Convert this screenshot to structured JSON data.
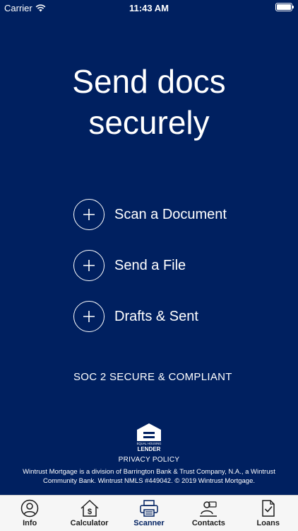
{
  "status_bar": {
    "carrier": "Carrier",
    "time": "11:43 AM"
  },
  "headline": {
    "line1": "Send docs",
    "line2": "securely"
  },
  "actions": [
    {
      "label": "Scan a Document"
    },
    {
      "label": "Send a File"
    },
    {
      "label": "Drafts & Sent"
    }
  ],
  "soc": "SOC 2 SECURE & COMPLIANT",
  "equal_housing": {
    "top": "EQUAL HOUSING",
    "bottom": "LENDER"
  },
  "privacy_policy": "PRIVACY POLICY",
  "disclaimer": "Wintrust Mortgage is a division of Barrington Bank & Trust Company, N.A., a Wintrust Community Bank. Wintrust NMLS #449042. © 2019 Wintrust Mortgage.",
  "tabs": [
    {
      "label": "Info",
      "icon": "person-icon"
    },
    {
      "label": "Calculator",
      "icon": "house-dollar-icon"
    },
    {
      "label": "Scanner",
      "icon": "printer-icon",
      "active": true
    },
    {
      "label": "Contacts",
      "icon": "contacts-icon"
    },
    {
      "label": "Loans",
      "icon": "document-check-icon"
    }
  ],
  "colors": {
    "background": "#002060",
    "tab_active": "#002060",
    "tab_bar": "#f6f6f6"
  }
}
